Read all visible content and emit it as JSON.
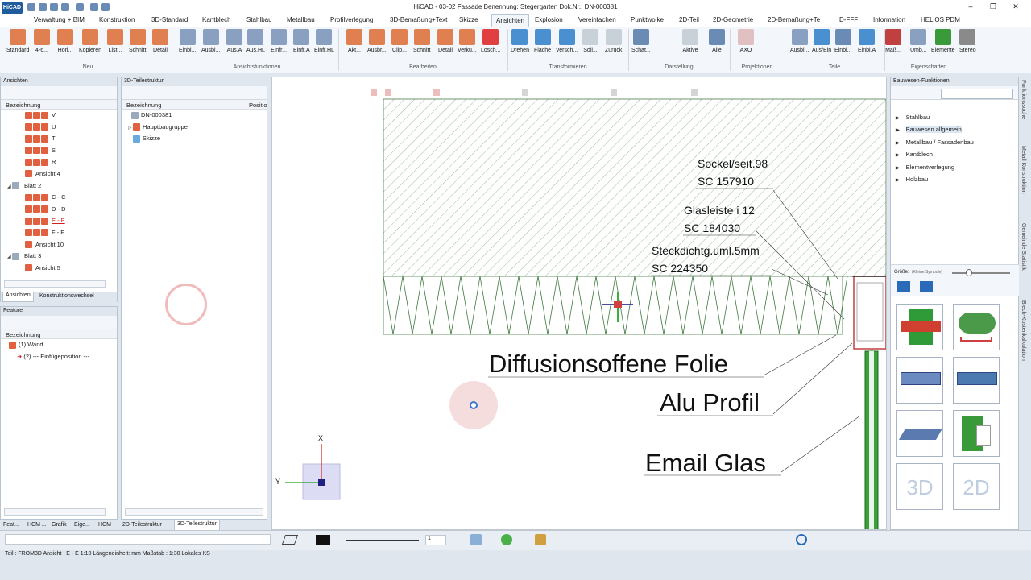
{
  "window": {
    "title": "HiCAD - 03-02 Fassade  Benennung: Stegergarten  Dok.Nr.: DN-000381"
  },
  "ribbon_tabs": [
    "Verwaltung + BIM",
    "Konstruktion",
    "3D-Standard",
    "Kantblech",
    "Stahlbau",
    "Metallbau",
    "Profilverlegung",
    "3D-Bemaßung+Text",
    "Skizze",
    "Ansichten",
    "Explosion",
    "Vereinfachen",
    "Punktwolke",
    "2D-Teil",
    "2D-Geometrie",
    "2D-Bemaßung+Te",
    "D-FFF",
    "Information",
    "HELiOS PDM"
  ],
  "active_tab": "Ansichten",
  "ribbon_buttons": [
    "Standard",
    "4-6...",
    "Hori...",
    "Kopieren",
    "List...",
    "Schnitt",
    "Detail",
    "Einbl...",
    "Ausbl...",
    "Aus.A",
    "Aus.HL",
    "Einfr...",
    "Einfr.A",
    "Einfr.HL",
    "Akt...",
    "Ausbr...",
    "Clip...",
    "Schnitt",
    "Detail",
    "Verkü...",
    "Lösch...",
    "Drehen",
    "Fläche",
    "Versch...",
    "Soll...",
    "Zurück",
    "Schat...",
    "Aktive",
    "Alle",
    "AXO",
    "Ausbl...",
    "Aus/Ein",
    "Einbl...",
    "Einbl.A",
    "Maß...",
    "Umb...",
    "Elemente",
    "Stereo"
  ],
  "ribbon_groups": [
    "Neu",
    "Ansichtsfunktionen",
    "Bearbeiten",
    "Transformieren",
    "Darstellung",
    "Projektionen",
    "Teile",
    "Eigenschaften"
  ],
  "ansichten_panel": {
    "title": "Ansichten",
    "column": "Bezeichnung",
    "rows": [
      {
        "label": "V",
        "level": 2,
        "red": false
      },
      {
        "label": "U",
        "level": 2,
        "red": false
      },
      {
        "label": "T",
        "level": 2,
        "red": false
      },
      {
        "label": "S",
        "level": 2,
        "red": false
      },
      {
        "label": "R",
        "level": 2,
        "red": false
      },
      {
        "label": "Ansicht 4",
        "level": 2,
        "red": false
      },
      {
        "label": "Blatt 2",
        "level": 1,
        "red": false
      },
      {
        "label": "C - C",
        "level": 2,
        "red": false
      },
      {
        "label": "D - D",
        "level": 2,
        "red": false
      },
      {
        "label": "E - E",
        "level": 2,
        "red": true
      },
      {
        "label": "F - F",
        "level": 2,
        "red": false
      },
      {
        "label": "Ansicht 10",
        "level": 2,
        "red": false
      },
      {
        "label": "Blatt 3",
        "level": 1,
        "red": false
      },
      {
        "label": "Ansicht 5",
        "level": 2,
        "red": false
      }
    ],
    "tabs": [
      "Ansichten",
      "Konstruktionswechsel"
    ]
  },
  "feature_panel": {
    "title": "Feature",
    "column": "Bezeichnung",
    "rows": [
      "(1) Wand",
      "(2) --- Einfügeposition ---"
    ]
  },
  "struktur_panel": {
    "title": "3D-Teilestruktur",
    "columns": [
      "Bezeichnung",
      "Positio"
    ],
    "rows": [
      "DN-000381",
      "Hauptbaugruppe",
      "Skizze"
    ]
  },
  "bottom_tabs": [
    "Feat...",
    "HCM ...",
    "Grafik",
    "Eige...",
    "HCM",
    "2D-Teilestruktur",
    "3D-Teilestruktur"
  ],
  "drawing": {
    "labels": [
      {
        "line1": "Sockel/seit.98",
        "line2": "SC  157910"
      },
      {
        "line1": "Glasleiste i 12",
        "line2": "SC  184030"
      },
      {
        "line1": "Steckdichtg.uml.5mm",
        "line2": "SC  224350"
      }
    ],
    "big_labels": [
      "Diffusionsoffene Folie",
      "Alu Profil",
      "Email Glas"
    ],
    "axis_x": "X",
    "axis_y": "Y"
  },
  "right_panel": {
    "title": "Bauwesen-Funktionen",
    "items": [
      "Stahlbau",
      "Bauwesen allgemein",
      "Metallbau / Fassadenbau",
      "Kantblech",
      "Elementverlegung",
      "Holzbau"
    ],
    "selected": "Bauwesen allgemein",
    "size_label": "Größe:",
    "size_hint": "(Kleine Symbole)",
    "thumb_text": [
      "3D",
      "2D"
    ]
  },
  "vertical_tabs": [
    "Funktionssuche",
    "Metall Konstruktion",
    "Gemeinde Statistik",
    "Blech-Kostenkalkulation"
  ],
  "toolbar_bottom": {
    "line_value": "1"
  },
  "status": "Teil : FROM3D  Ansicht : E - E 1:10  Längeneinheit: mm  Maßstab : 1:30  Lokales KS",
  "colors": {
    "accent": "#1f5c9e",
    "hatch": "#3d7a3d",
    "glass": "#2c8c2c",
    "selection": "#e05050"
  }
}
